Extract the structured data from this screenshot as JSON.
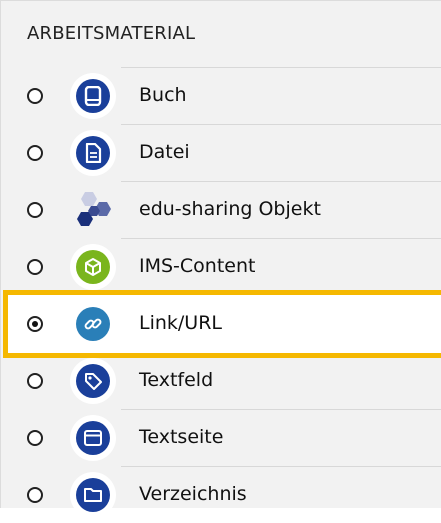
{
  "section": {
    "title": "ARBEITSMATERIAL"
  },
  "items": [
    {
      "label": "Buch",
      "icon": "book-icon",
      "selected": false,
      "color": "#1a3f9a"
    },
    {
      "label": "Datei",
      "icon": "file-icon",
      "selected": false,
      "color": "#1a3f9a"
    },
    {
      "label": "edu-sharing Objekt",
      "icon": "edu-sharing-hexagons-icon",
      "selected": false,
      "color": "#4a5a9a"
    },
    {
      "label": "IMS-Content",
      "icon": "package-icon",
      "selected": false,
      "color": "#7ab51d"
    },
    {
      "label": "Link/URL",
      "icon": "link-icon",
      "selected": true,
      "color": "#2a7fb8"
    },
    {
      "label": "Textfeld",
      "icon": "tag-icon",
      "selected": false,
      "color": "#1a3f9a"
    },
    {
      "label": "Textseite",
      "icon": "window-icon",
      "selected": false,
      "color": "#1a3f9a"
    },
    {
      "label": "Verzeichnis",
      "icon": "folder-icon",
      "selected": false,
      "color": "#1a3f9a"
    }
  ],
  "colors": {
    "highlight": "#f5b800",
    "panel_bg": "#f2f2f2"
  }
}
